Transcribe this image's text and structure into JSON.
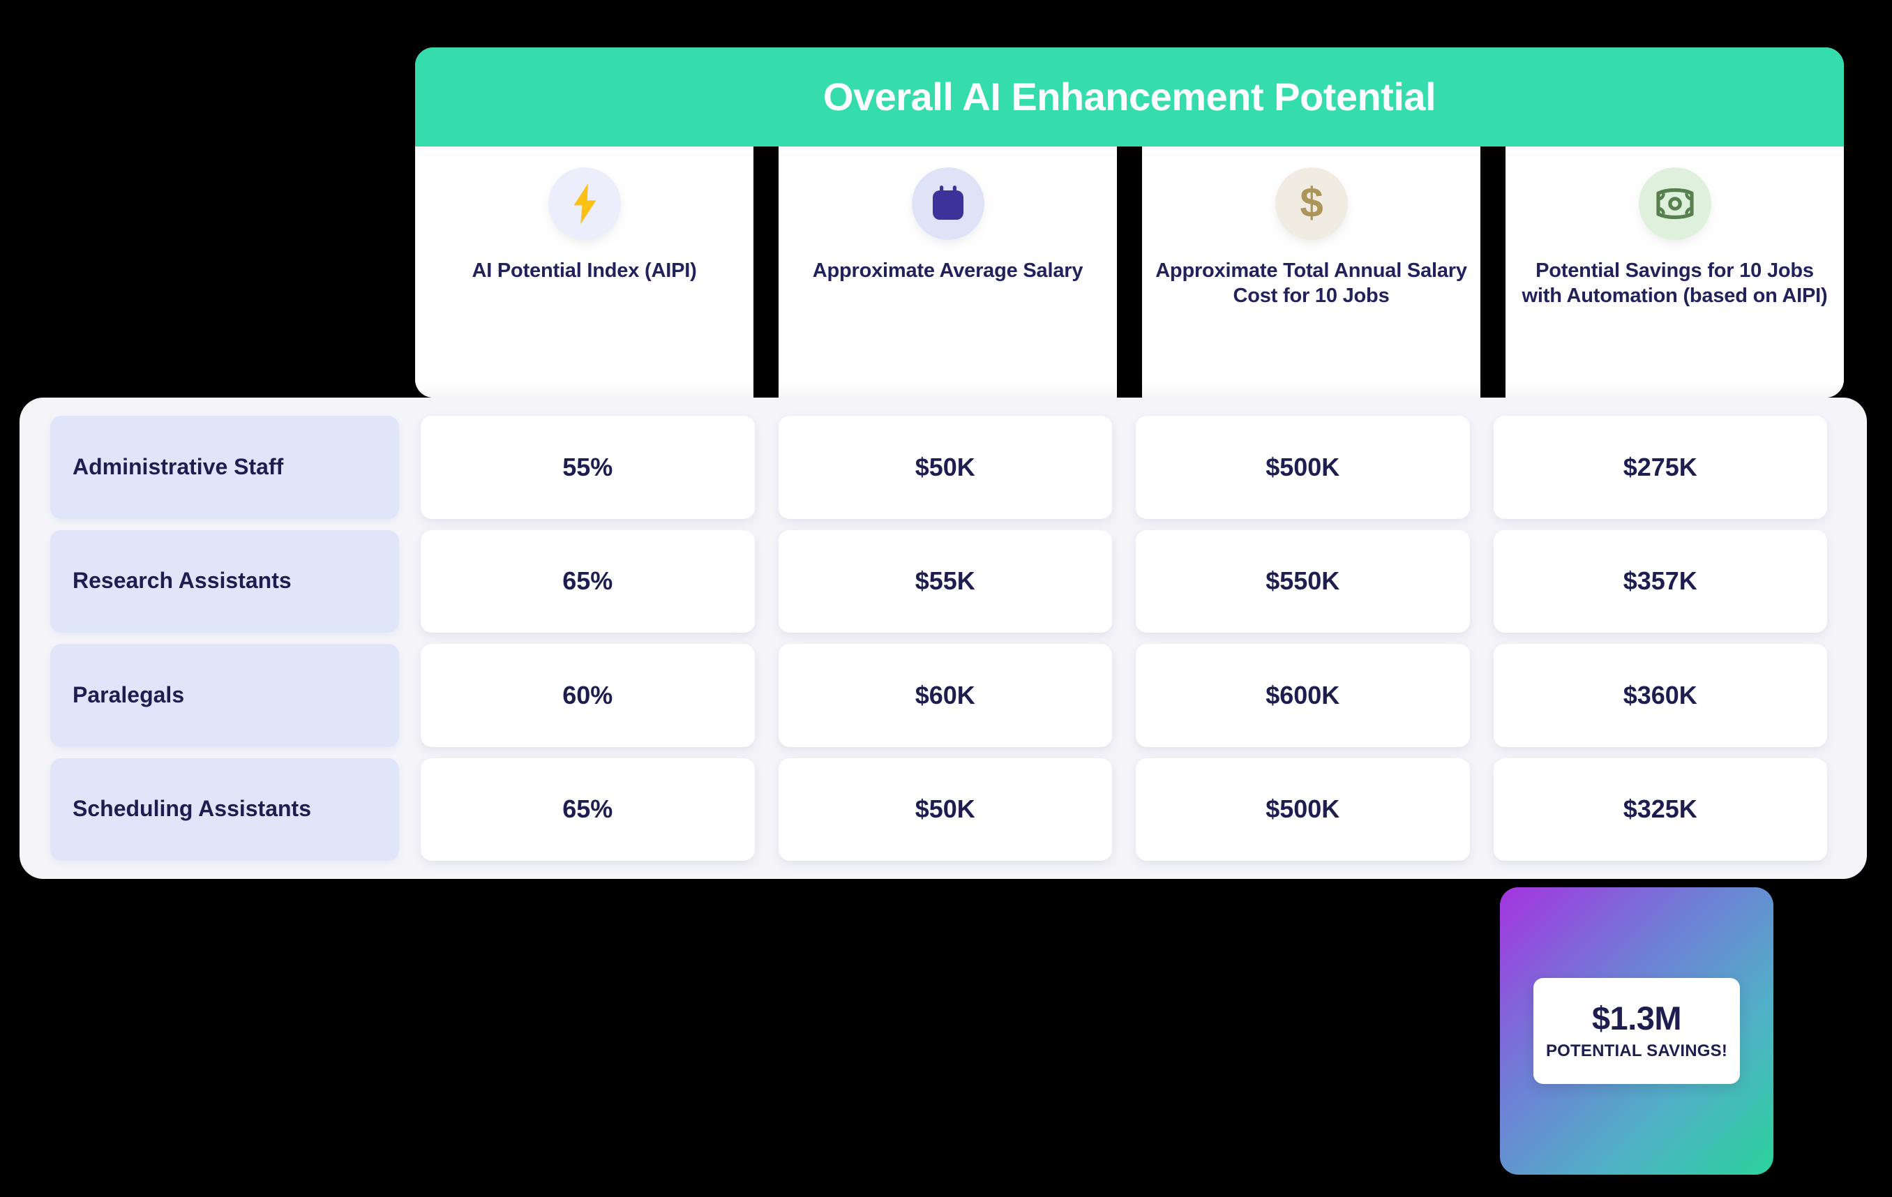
{
  "header": {
    "title": "Overall AI Enhancement Potential",
    "title_bar_color": "#35dcac",
    "columns": [
      {
        "icon": "lightning-bolt-icon",
        "icon_color": "#fbc115",
        "circle_color": "#eceefb",
        "label": "AI Potential Index (AIPI)"
      },
      {
        "icon": "calendar-icon",
        "icon_color": "#3b3399",
        "circle_color": "#dfe3f8",
        "label": "Approximate Average Salary"
      },
      {
        "icon": "dollar-sign-icon",
        "icon_color": "#ab9559",
        "circle_color": "#f0ece2",
        "label": "Approximate Total Annual Salary Cost for 10 Jobs"
      },
      {
        "icon": "banknote-icon",
        "icon_color": "#57804e",
        "circle_color": "#dff0dd",
        "label": "Potential Savings for 10 Jobs with Automation (based on AIPI)"
      }
    ]
  },
  "chart_data": {
    "type": "table",
    "title": "Overall AI Enhancement Potential",
    "columns": [
      "AI Potential Index (AIPI)",
      "Approximate Average Salary",
      "Approximate Total Annual Salary Cost for 10 Jobs",
      "Potential Savings for 10 Jobs with Automation (based on AIPI)"
    ],
    "rows": [
      {
        "label": "Administrative Staff",
        "cells": [
          "55%",
          "$50K",
          "$500K",
          "$275K"
        ]
      },
      {
        "label": "Research Assistants",
        "cells": [
          "65%",
          "$55K",
          "$550K",
          "$357K"
        ]
      },
      {
        "label": "Paralegals",
        "cells": [
          "60%",
          "$60K",
          "$600K",
          "$360K"
        ]
      },
      {
        "label": "Scheduling Assistants",
        "cells": [
          "65%",
          "$50K",
          "$500K",
          "$325K"
        ]
      }
    ]
  },
  "savings_badge": {
    "amount": "$1.3M",
    "caption": "POTENTIAL SAVINGS!",
    "gradient_from": "#a434e0",
    "gradient_to": "#2ad39b"
  }
}
